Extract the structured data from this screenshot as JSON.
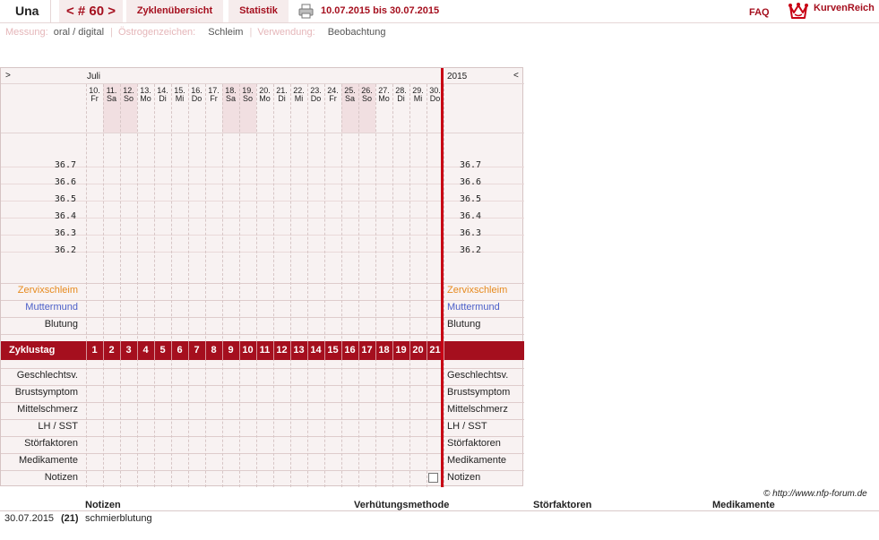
{
  "header": {
    "name": "Una",
    "cycle": "< # 60 >",
    "tabs": [
      "Zyklenübersicht",
      "Statistik"
    ],
    "date_range": "10.07.2015 bis 30.07.2015",
    "faq": "FAQ",
    "logo_text": "KurvenReich"
  },
  "settings": {
    "messung_label": "Messung:",
    "messung_value": "oral / digital",
    "oestrogen_label": "Östrogenzeichen:",
    "oestrogen_value": "Schleim",
    "verwendung_label": "Verwendung:",
    "verwendung_value": "Beobachtung"
  },
  "chart": {
    "nav_left": ">",
    "nav_right": "<",
    "month": "Juli",
    "year": "2015",
    "days": [
      {
        "d": "10.",
        "w": "Fr"
      },
      {
        "d": "11.",
        "w": "Sa"
      },
      {
        "d": "12.",
        "w": "So"
      },
      {
        "d": "13.",
        "w": "Mo"
      },
      {
        "d": "14.",
        "w": "Di"
      },
      {
        "d": "15.",
        "w": "Mi"
      },
      {
        "d": "16.",
        "w": "Do"
      },
      {
        "d": "17.",
        "w": "Fr"
      },
      {
        "d": "18.",
        "w": "Sa"
      },
      {
        "d": "19.",
        "w": "So"
      },
      {
        "d": "20.",
        "w": "Mo"
      },
      {
        "d": "21.",
        "w": "Di"
      },
      {
        "d": "22.",
        "w": "Mi"
      },
      {
        "d": "23.",
        "w": "Do"
      },
      {
        "d": "24.",
        "w": "Fr"
      },
      {
        "d": "25.",
        "w": "Sa"
      },
      {
        "d": "26.",
        "w": "So"
      },
      {
        "d": "27.",
        "w": "Mo"
      },
      {
        "d": "28.",
        "w": "Di"
      },
      {
        "d": "29.",
        "w": "Mi"
      },
      {
        "d": "30.",
        "w": "Do"
      }
    ],
    "weekend_days": [
      "11.",
      "12.",
      "18.",
      "19.",
      "25.",
      "26."
    ],
    "temperatures": [
      "36.7",
      "36.6",
      "36.5",
      "36.4",
      "36.3",
      "36.2"
    ],
    "rows_top": [
      {
        "label": "Zervixschleim",
        "color": "#e68a1e"
      },
      {
        "label": "Muttermund",
        "color": "#4b5fc8"
      },
      {
        "label": "Blutung",
        "color": "#222222"
      }
    ],
    "zyklustag_label": "Zyklustag",
    "zyklustage": [
      "1",
      "2",
      "3",
      "4",
      "5",
      "6",
      "7",
      "8",
      "9",
      "10",
      "11",
      "12",
      "13",
      "14",
      "15",
      "16",
      "17",
      "18",
      "19",
      "20",
      "21"
    ],
    "rows_bottom": [
      "Geschlechtsv.",
      "Brustsymptom",
      "Mittelschmerz",
      "LH / SST",
      "Störfaktoren",
      "Medikamente",
      "Notizen"
    ]
  },
  "footer": {
    "copyright": "© http://www.nfp-forum.de",
    "columns": [
      "Notizen",
      "Verhütungsmethode",
      "Störfaktoren",
      "Medikamente"
    ],
    "notes": [
      {
        "date": "30.07.2015",
        "day": "(21)",
        "text": "schmierblutung"
      }
    ]
  },
  "colors": {
    "accent": "#a50f1e",
    "red_line": "#c80014",
    "chart_bg": "#f8f2f2",
    "weekend_bg": "#f1dfe1"
  }
}
